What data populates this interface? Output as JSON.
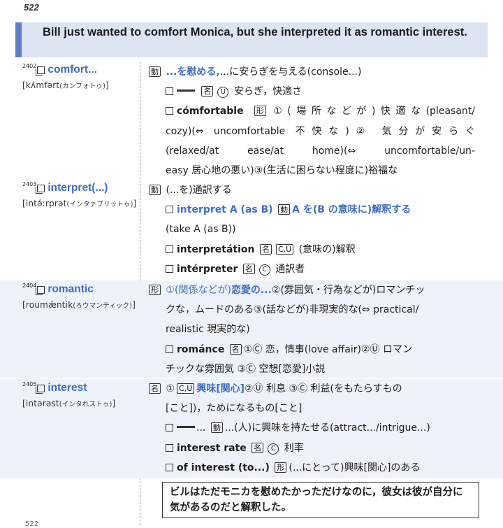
{
  "page_number": "522",
  "sentence": "Bill just wanted to comfort Monica, but she interpreted it as romantic interest.",
  "translation": "ビルはただモニカを慰めたかっただけなのに，彼女は彼が自分に気があるのだと解釈した。",
  "footer_number": "522",
  "entries": [
    {
      "num": "2402",
      "headword": "comfort...",
      "pron_main": "[kʌ́mfərt",
      "pron_kana": "(カンフォトゥ)",
      "pron_end": "]",
      "pos": "動",
      "lines": [
        {
          "def": "...を慰める,",
          "rest": "...に安らぎを与える(console...)"
        },
        {
          "pos": "名",
          "circ": "U",
          "text": "安らぎ，快適さ"
        },
        {
          "word": "cómfortable",
          "pos": "形",
          "text": "①(場所などが)快適な(pleasant/"
        },
        {
          "text": "cozy)(⇔ uncomfortable 不快な)② 気分が安らぐ"
        },
        {
          "text": "(relaxed/at ease/at home)(⇔ uncomfortable/un-"
        },
        {
          "text": "easy 居心地の悪い)③(生活に困らない程度に)裕福な"
        }
      ]
    },
    {
      "num": "2403",
      "headword": "interpret(...)",
      "pron_main": "[intə́ːrprət",
      "pron_kana": "(インタァプリットゥ)",
      "pron_end": "]",
      "pos": "動",
      "lines": [
        {
          "rest": "(...を)通訳する"
        },
        {
          "word": "interpret A (as B)",
          "pos": "動",
          "def": "A を(B の意味に)解釈する"
        },
        {
          "text": "(take A (as B))"
        },
        {
          "word": "interpretátion",
          "pos": "名",
          "box2": "C,U",
          "text": "(意味の)解釈"
        },
        {
          "word": "intérpreter",
          "pos": "名",
          "circ": "C",
          "text": "通訳者"
        }
      ]
    },
    {
      "num": "2404",
      "headword": "romantic",
      "pron_main": "[roumǽntik",
      "pron_kana": "(ろウマンティック)",
      "pron_end": "]",
      "pos": "形",
      "lines": [
        {
          "blue": "①(関係などが)",
          "def": "恋愛の...",
          "rest": "②(雰囲気・行為などが)ロマンチッ"
        },
        {
          "text": "クな，ムードのある③(話などが)非現実的な(⇔ practical/"
        },
        {
          "text": "realistic 現実的な)"
        },
        {
          "word": "románce",
          "pos": "名",
          "text": "①Ⓒ 恋，情事(love affair)②Ⓤ ロマン"
        },
        {
          "text": "チックな雰囲気 ③Ⓒ 空想[恋愛]小説"
        }
      ]
    },
    {
      "num": "2405",
      "headword": "interest",
      "pron_main": "[intərəst",
      "pron_kana": "(インタれストゥ)",
      "pron_end": "]",
      "pos": "名",
      "lines": [
        {
          "box2": "C,U",
          "def": "興味[関心]",
          "rest": "②Ⓤ 利息 ③Ⓒ 利益(をもたらすもの"
        },
        {
          "text": "[こと])，ためになるもの[こと]"
        },
        {
          "pos": "動",
          "text": "...(人)に興味を持たせる(attract.../intrigue...)"
        },
        {
          "word": "interest rate",
          "pos": "名",
          "circ": "C",
          "text": "利率"
        },
        {
          "word": "of interest (to...)",
          "pos": "形",
          "text": "(...にとって)興味[関心]のある"
        }
      ]
    }
  ]
}
